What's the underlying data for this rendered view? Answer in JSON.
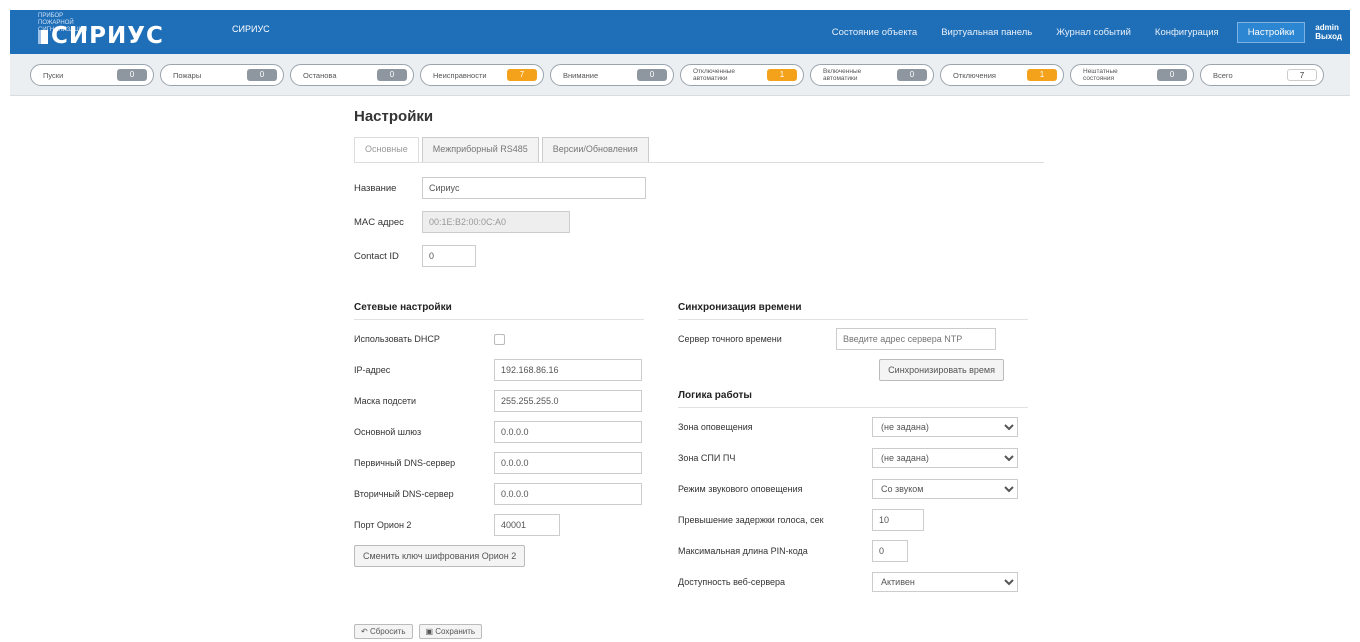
{
  "header": {
    "logo_small": "ПРИБОР ПОЖАРНОЙ СИГНАЛИЗАЦИИ",
    "logo_main": "СИРИУС",
    "device_name": "СИРИУС",
    "nav": [
      "Состояние объекта",
      "Виртуальная панель",
      "Журнал событий",
      "Конфигурация",
      "Настройки"
    ],
    "active_nav": "Настройки",
    "user_line1": "admin",
    "user_line2": "Выход"
  },
  "status_chips": [
    {
      "label": "Пуски",
      "count": "0",
      "level": "normal"
    },
    {
      "label": "Пожары",
      "count": "0",
      "level": "normal"
    },
    {
      "label": "Останова",
      "count": "0",
      "level": "normal"
    },
    {
      "label": "Неисправности",
      "count": "7",
      "level": "warn"
    },
    {
      "label": "Внимание",
      "count": "0",
      "level": "normal"
    },
    {
      "label": "Отключенные автоматики",
      "count": "1",
      "level": "warn"
    },
    {
      "label": "Включенные автоматики",
      "count": "0",
      "level": "normal"
    },
    {
      "label": "Отключения",
      "count": "1",
      "level": "warn"
    },
    {
      "label": "Нештатные состояния",
      "count": "0",
      "level": "normal"
    },
    {
      "label": "Всего",
      "count": "7",
      "level": "total"
    }
  ],
  "page": {
    "title": "Настройки",
    "tabs": [
      "Основные",
      "Межприборный RS485",
      "Версии/Обновления"
    ],
    "name_label": "Название",
    "name_value": "Сириус",
    "mac_label": "MAC адрес",
    "mac_value": "00:1E:B2:00:0C:A0",
    "contact_label": "Contact ID",
    "contact_value": "0"
  },
  "network": {
    "title": "Сетевые настройки",
    "dhcp_label": "Использовать DHCP",
    "ip_label": "IP-адрес",
    "ip_value": "192.168.86.16",
    "mask_label": "Маска подсети",
    "mask_value": "255.255.255.0",
    "gw_label": "Основной шлюз",
    "gw_value": "0.0.0.0",
    "dns1_label": "Первичный DNS-сервер",
    "dns1_value": "0.0.0.0",
    "dns2_label": "Вторичный DNS-сервер",
    "dns2_value": "0.0.0.0",
    "port_label": "Порт Орион 2",
    "port_value": "40001",
    "key_button": "Сменить ключ шифрования Орион 2"
  },
  "time": {
    "title": "Синхронизация времени",
    "server_label": "Сервер точного времени",
    "server_placeholder": "Введите адрес сервера NTP",
    "sync_button": "Синхронизировать время"
  },
  "logic": {
    "title": "Логика работы",
    "zone_alert_label": "Зона оповещения",
    "zone_alert_value": "(не задана)",
    "zone_spi_label": "Зона СПИ ПЧ",
    "zone_spi_value": "(не задана)",
    "sound_mode_label": "Режим звукового оповещения",
    "sound_mode_value": "Со звуком",
    "voice_delay_label": "Превышение задержки голоса, сек",
    "voice_delay_value": "10",
    "pin_len_label": "Максимальная длина PIN-кода",
    "pin_len_value": "0",
    "web_label": "Доступность веб-сервера",
    "web_value": "Активен"
  },
  "footer": {
    "reset": "Сбросить",
    "save": "Сохранить"
  },
  "colors": {
    "header_bg": "#1f6fb8",
    "warn": "#f4a21c",
    "neutral_badge": "#8e979f"
  }
}
